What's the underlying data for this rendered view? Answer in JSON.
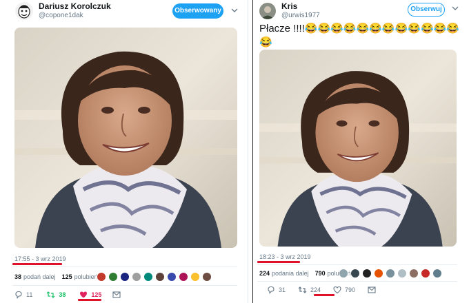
{
  "left_tweet": {
    "display_name": "Dariusz Korolczuk",
    "handle": "@copone1dak",
    "follow_label": "Obserwowany",
    "timestamp": "17:55 - 3 wrz 2019",
    "retweets_count": "38",
    "retweets_label": "podań dalej",
    "likes_count": "125",
    "likes_label": "polubień",
    "reply_count": "11",
    "retweet_action_count": "38",
    "like_action_count": "125",
    "liker_colors": [
      "#c0392b",
      "#2e7d32",
      "#1a237e",
      "#9e9e9e",
      "#00897b",
      "#5d4037",
      "#3949ab",
      "#ad1457",
      "#fbc02d",
      "#6d4c41"
    ]
  },
  "right_tweet": {
    "display_name": "Kris",
    "handle": "@urwis1977",
    "follow_label": "Obserwuj",
    "text": "Płacze !!!!😂😂😂😂😂😂😂😂😂😂😂😂😂",
    "timestamp": "18:23 - 3 wrz 2019",
    "retweets_count": "224",
    "retweets_label": "podania dalej",
    "likes_count": "790",
    "likes_label": "polubień",
    "reply_count": "31",
    "retweet_action_count": "224",
    "like_action_count": "790",
    "liker_colors": [
      "#90a4ae",
      "#37474f",
      "#212121",
      "#e65100",
      "#78909c",
      "#b0bec5",
      "#8d6e63",
      "#c62828",
      "#607d8b"
    ]
  },
  "colors": {
    "accent_blue": "#1da1f2",
    "like_red": "#e0245e",
    "retweet_green": "#17bf63",
    "annotation_red": "#e0112b"
  },
  "icons": [
    "chevron-down-icon",
    "reply-icon",
    "retweet-icon",
    "heart-icon",
    "mail-icon"
  ]
}
